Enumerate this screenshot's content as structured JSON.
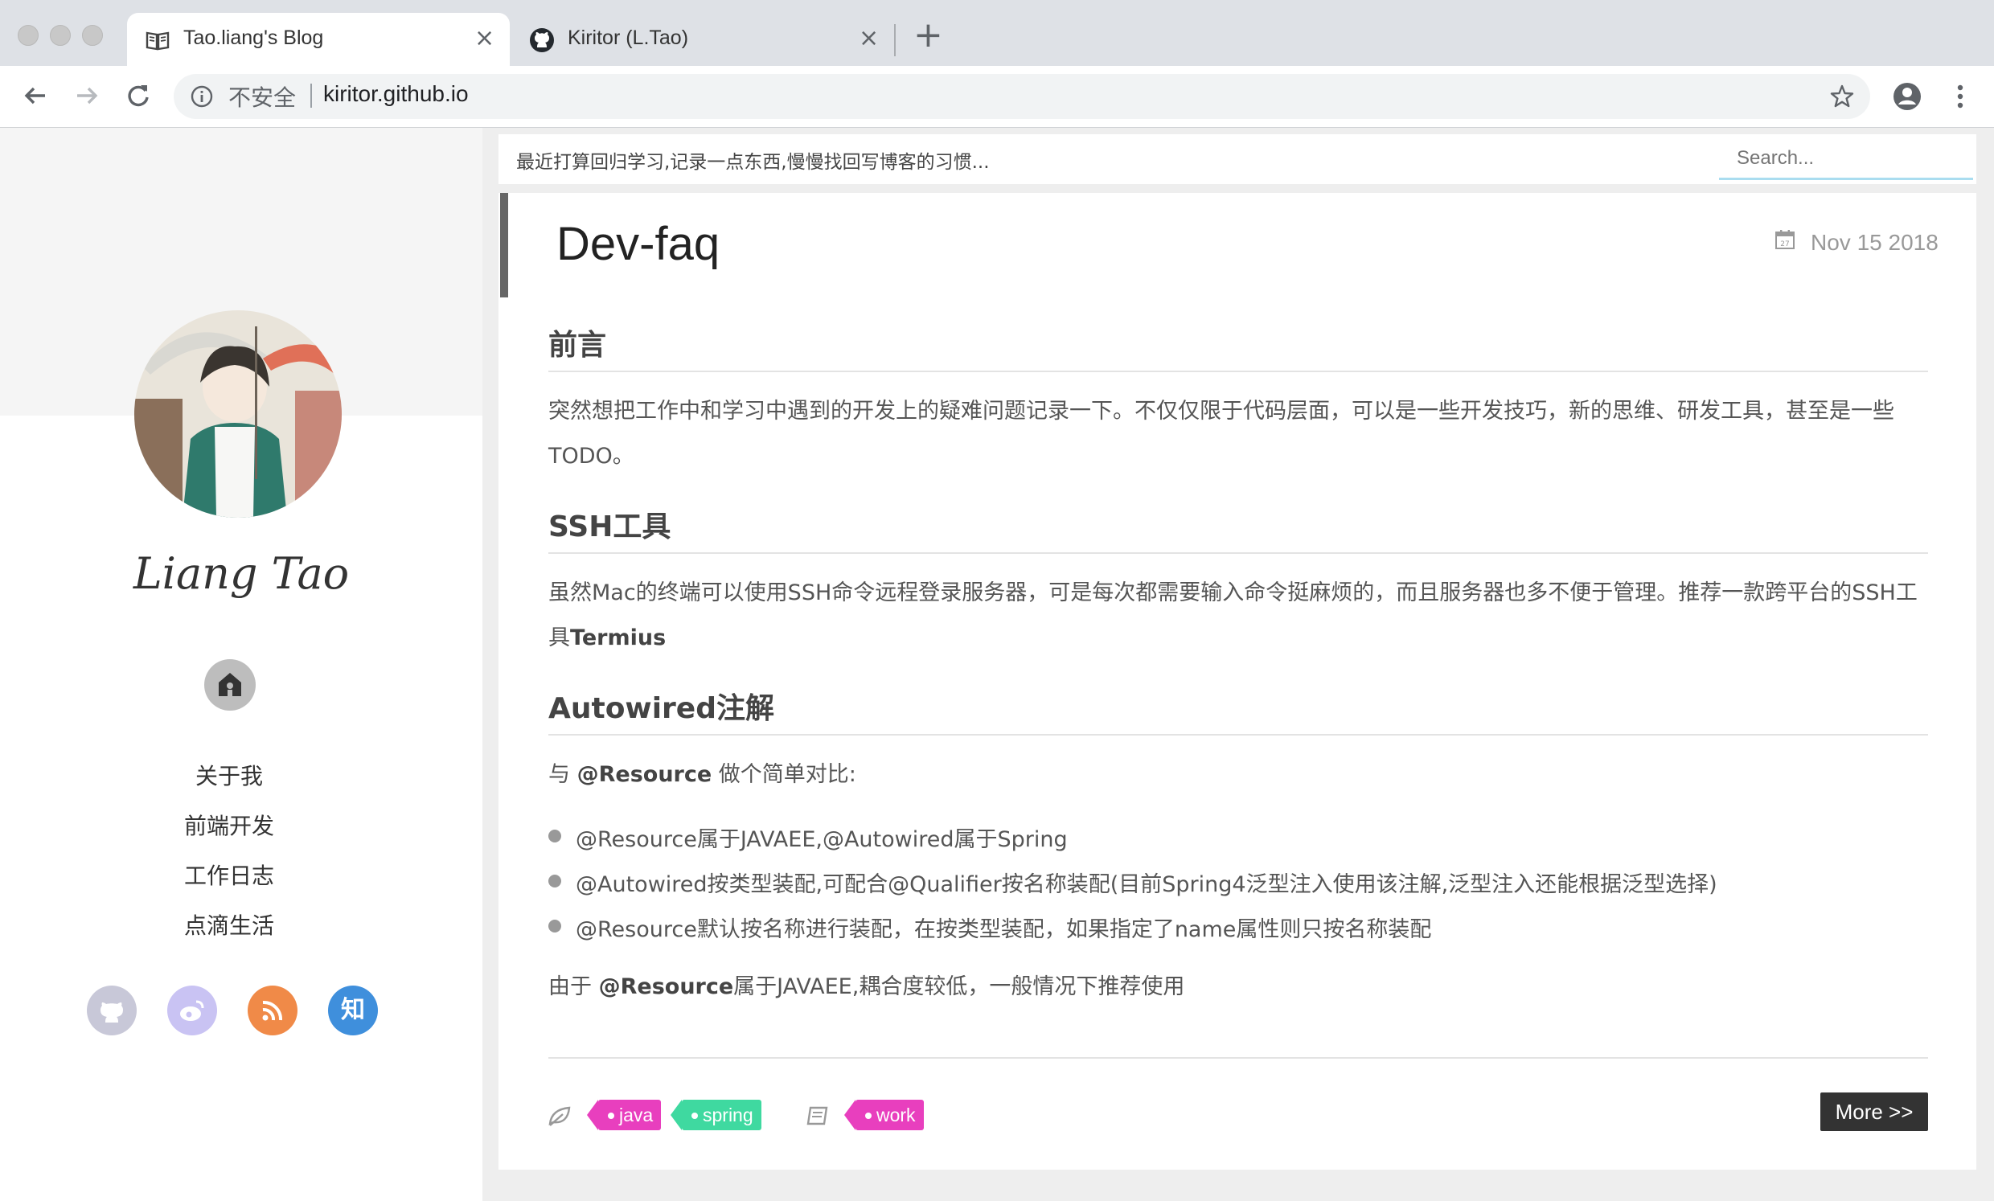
{
  "browser": {
    "tabs": [
      {
        "title": "Tao.liang's Blog",
        "active": true
      },
      {
        "title": "Kiritor (L.Tao)",
        "active": false
      }
    ],
    "omnibox": {
      "security_label": "不安全",
      "url": "kiritor.github.io"
    }
  },
  "sidebar": {
    "author": "Liang Tao",
    "nav": [
      "关于我",
      "前端开发",
      "工作日志",
      "点滴生活"
    ],
    "social": [
      {
        "icon": "github-icon",
        "color": "#c8c8d8"
      },
      {
        "icon": "weibo-icon",
        "color": "#c9c3f3"
      },
      {
        "icon": "rss-icon",
        "color": "#f08a48"
      },
      {
        "icon": "zhihu-icon",
        "color": "#3f8fdc",
        "glyph": "知"
      }
    ]
  },
  "topbar": {
    "notice": "最近打算回归学习,记录一点东西,慢慢找回写博客的习惯...",
    "search_placeholder": "Search..."
  },
  "post": {
    "title": "Dev-faq",
    "date": "Nov 15 2018",
    "sections": [
      {
        "heading": "前言",
        "text": "突然想把工作中和学习中遇到的开发上的疑难问题记录一下。不仅仅限于代码层面，可以是一些开发技巧，新的思维、研发工具，甚至是一些TODO。"
      },
      {
        "heading": "SSH工具",
        "text_before": "虽然Mac的终端可以使用SSH命令远程登录服务器，可是每次都需要输入命令挺麻烦的，而且服务器也多不便于管理。推荐一款跨平台的SSH工具",
        "bold": "Termius"
      },
      {
        "heading": "Autowired注解",
        "intro_before": "与 ",
        "intro_bold": "@Resource",
        "intro_after": " 做个简单对比:",
        "items": [
          "@Resource属于JAVAEE,@Autowired属于Spring",
          "@Autowired按类型装配,可配合@Qualifier按名称装配(目前Spring4泛型注入使用该注解,泛型注入还能根据泛型选择)",
          "@Resource默认按名称进行装配，在按类型装配，如果指定了name属性则只按名称装配"
        ],
        "outro_before": "由于 ",
        "outro_bold": "@Resource",
        "outro_after": "属于JAVAEE,耦合度较低，一般情况下推荐使用"
      }
    ],
    "tags": [
      {
        "label": "java",
        "color": "#e83fbe"
      },
      {
        "label": "spring",
        "color": "#3fd9a0"
      }
    ],
    "categories": [
      {
        "label": "work",
        "color": "#e83fbe"
      }
    ],
    "more_label": "More >>"
  }
}
